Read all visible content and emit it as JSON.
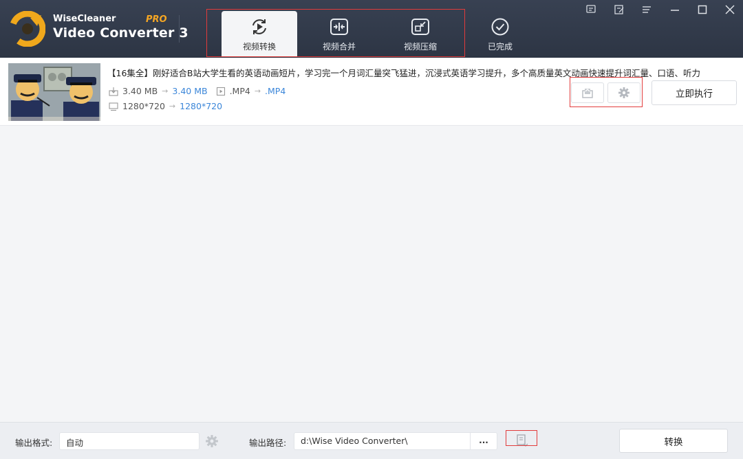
{
  "app": {
    "brand_line1": "WiseCleaner",
    "brand_line2": "Video Converter 3",
    "badge": "PRO"
  },
  "tabs": [
    {
      "label": "视频转换",
      "icon": "refresh-play-icon",
      "active": true
    },
    {
      "label": "视频合并",
      "icon": "merge-icon",
      "active": false
    },
    {
      "label": "视频压缩",
      "icon": "compress-icon",
      "active": false
    },
    {
      "label": "已完成",
      "icon": "check-circle-icon",
      "active": false
    }
  ],
  "window_controls": [
    "feedback-icon",
    "edit-note-icon",
    "menu-icon",
    "minimize-icon",
    "maximize-icon",
    "close-icon"
  ],
  "item": {
    "title": "【16集全】刚好适合B站大学生看的英语动画短片，学习完一个月词汇量突飞猛进，沉浸式英语学习提升，多个高质量英文动画快速提升词汇量、口语、听力",
    "size_from": "3.40 MB",
    "size_to": "3.40 MB",
    "format_from": ".MP4",
    "format_to": ".MP4",
    "res_from": "1280*720",
    "res_to": "1280*720",
    "arrow": "→",
    "run_label": "立即执行"
  },
  "footer": {
    "format_label": "输出格式:",
    "format_value": "自动",
    "path_label": "输出路径:",
    "path_value": "d:\\Wise Video Converter\\",
    "browse_label": "...",
    "convert_label": "转换"
  },
  "colors": {
    "header_bg": "#323a4a",
    "accent_blue": "#3b86d9",
    "pro_orange": "#f5a623",
    "highlight_red": "#e23b3b"
  }
}
